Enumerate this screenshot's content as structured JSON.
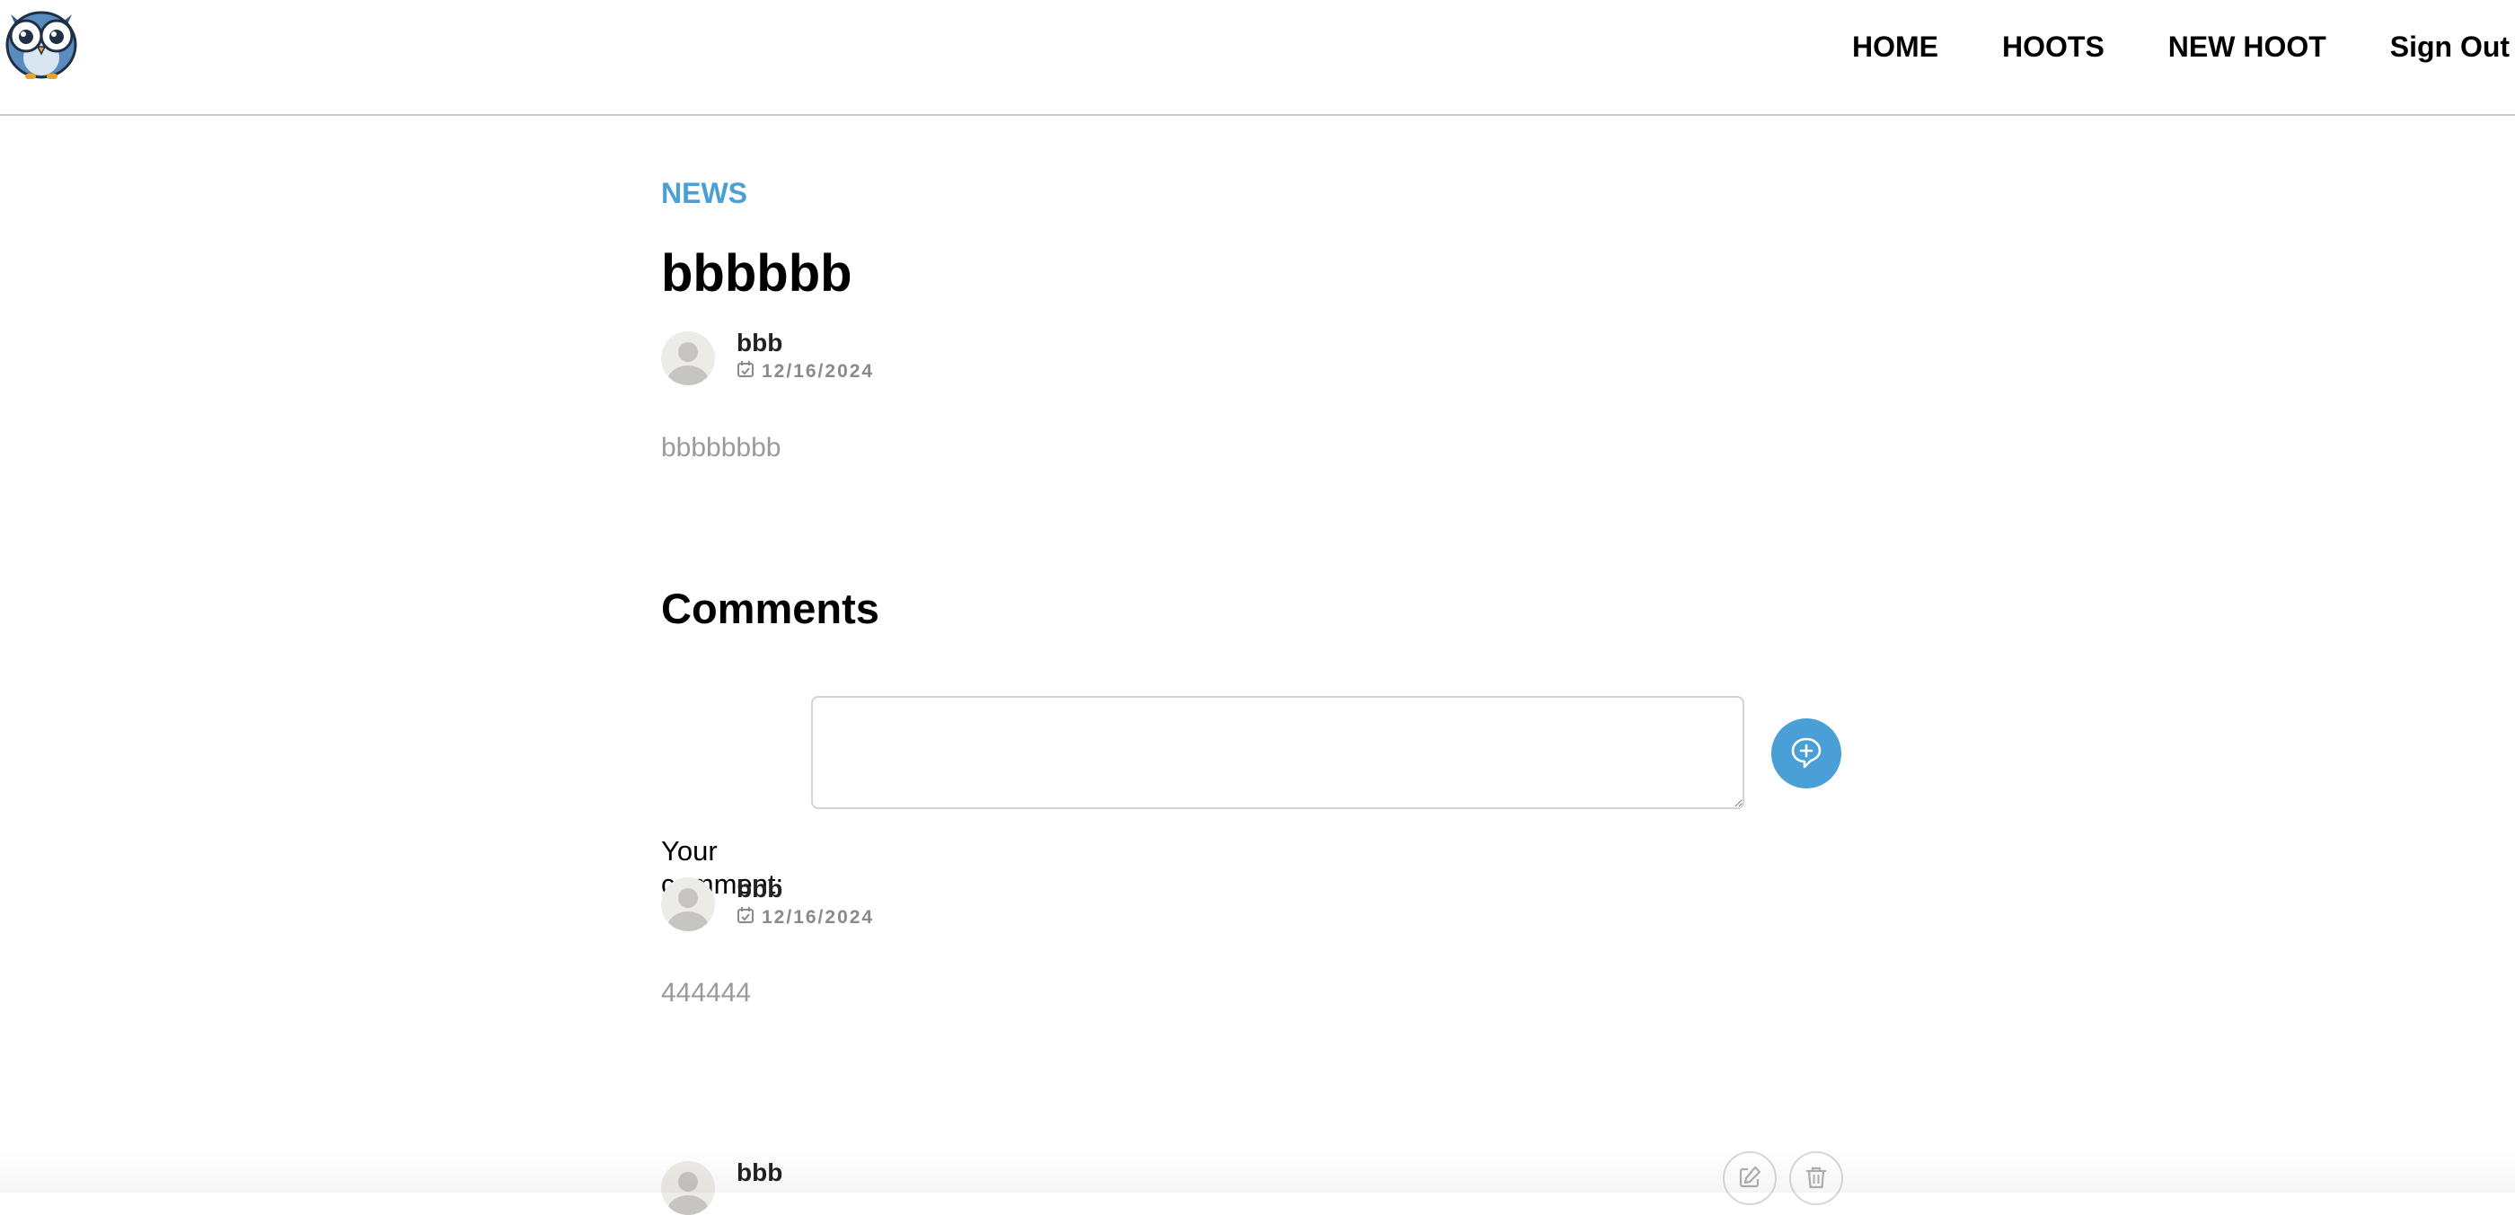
{
  "nav": {
    "links": [
      "HOME",
      "HOOTS",
      "NEW HOOT",
      "Sign Out"
    ]
  },
  "hoot": {
    "category": "NEWS",
    "title": "bbbbbb",
    "author": "bbb",
    "date": "12/16/2024",
    "text": "bbbbbbbb"
  },
  "comments": {
    "heading": "Comments",
    "form_label": "Your comment:",
    "textarea_value": "",
    "items": [
      {
        "author": "bbb",
        "date": "12/16/2024",
        "text": "444444"
      },
      {
        "author": "bbb"
      }
    ]
  },
  "colors": {
    "accent": "#4a9fd6",
    "muted_text": "#9a9a9a"
  },
  "icons": {
    "logo": "owl-logo-icon",
    "avatar": "user-avatar-icon",
    "date": "calendar-icon",
    "submit": "add-comment-icon",
    "edit": "edit-icon",
    "delete": "trash-icon"
  }
}
